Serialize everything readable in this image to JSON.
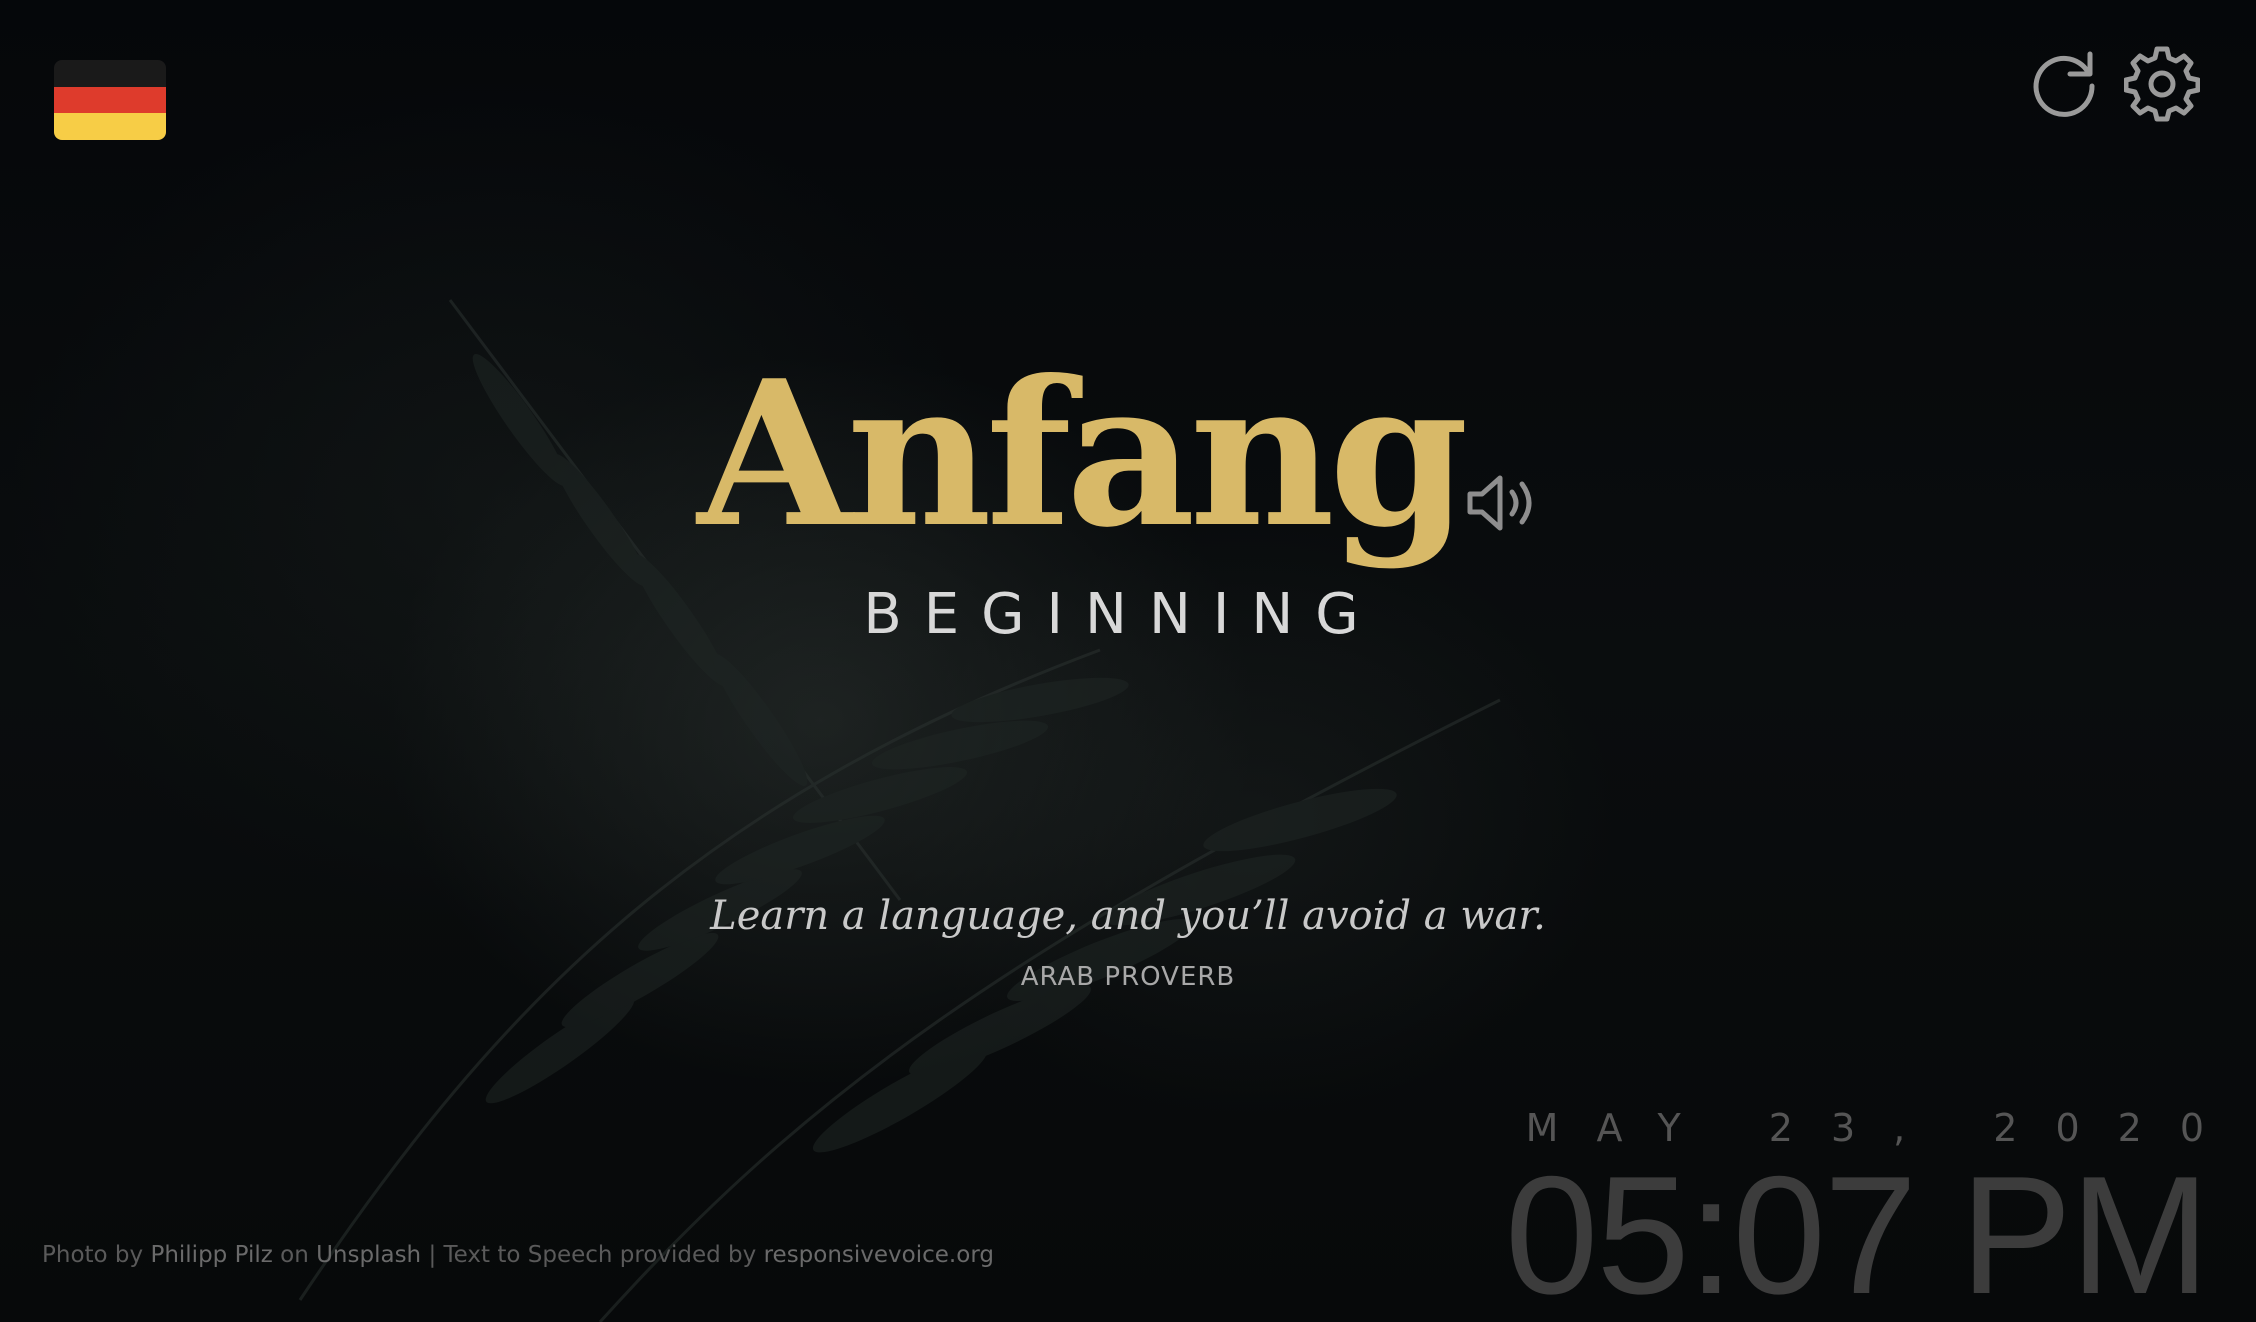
{
  "colors": {
    "word": "#d8b968",
    "flag_black": "#1a1a1a",
    "flag_red": "#de3b2c",
    "flag_gold": "#f7cd46",
    "icon": "#9a9a9a"
  },
  "language_flag": {
    "icon": "germany-flag-icon"
  },
  "toolbar": {
    "refresh_icon": "refresh-icon",
    "settings_icon": "gear-icon"
  },
  "word": {
    "text": "Anfang",
    "translation": "BEGINNING",
    "speaker_icon": "speaker-icon"
  },
  "quote": {
    "text": "Learn a language, and you’ll avoid a war.",
    "author": "ARAB PROVERB"
  },
  "clock": {
    "date": "MAY 23, 2020",
    "time": "05:07 PM"
  },
  "credits": {
    "photo_prefix": "Photo by",
    "photographer": "Philipp Pilz",
    "on": "on",
    "source": "Unsplash",
    "separator": "|",
    "tts_prefix": "Text to Speech provided by",
    "tts_provider": "responsivevoice.org"
  }
}
